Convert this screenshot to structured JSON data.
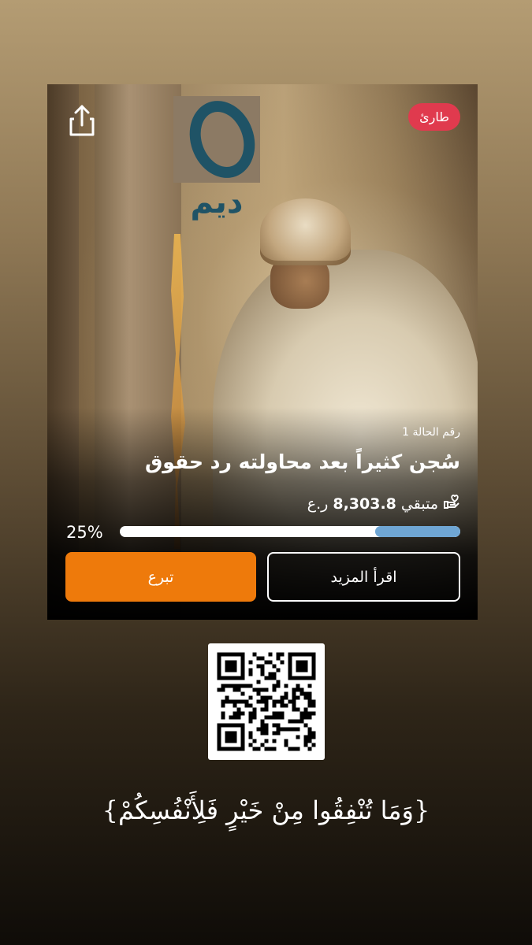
{
  "card": {
    "badge": "طارئ",
    "logo_text": "ديم",
    "case_number": "رقم الحالة 1",
    "title": "سُجن كثيراً بعد محاولته رد حقوق",
    "remaining_label": "متبقي",
    "remaining_amount": "8,303.8",
    "currency": "ر.ع",
    "progress_percent_label": "25%",
    "progress_fraction": 0.25,
    "donate_label": "تبرع",
    "read_more_label": "اقرأ المزيد",
    "share_icon": "share-icon",
    "hand_icon": "donation-hand-icon"
  },
  "verse": "{وَمَا تُنْفِقُوا مِنْ خَيْرٍ فَلِأَنْفُسِكُمْ}",
  "colors": {
    "badge": "#e03a4e",
    "donate_button": "#ee7a0b",
    "progress_fill": "#6fa6d4",
    "progress_track": "#ffffff"
  }
}
